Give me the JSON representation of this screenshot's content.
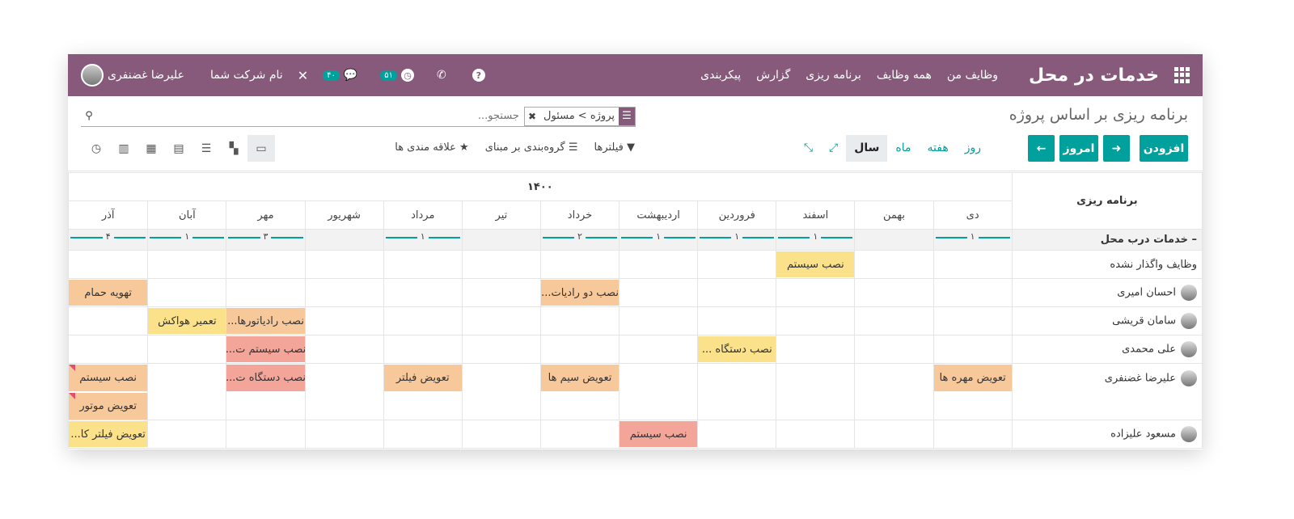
{
  "navbar": {
    "app_title": "خدمات در محل",
    "menu": [
      "وظایف من",
      "همه وظایف",
      "برنامه ریزی",
      "گزارش",
      "پیکربندی"
    ],
    "help_icon": "?",
    "activity_badge": "۵۱",
    "messages_badge": "۴۰",
    "company": "نام شرکت شما",
    "user": "علیرضا غضنفری",
    "colors": {
      "bar": "#875a7b",
      "badge": "#00a09d"
    }
  },
  "cp": {
    "breadcrumb": "برنامه ریزی بر اساس پروژه",
    "facet_value": "پروژه > مسئول",
    "search_placeholder": "جستجو...",
    "add_button": "افزودن",
    "today_button": "امروز",
    "scales": [
      "روز",
      "هفته",
      "ماه",
      "سال"
    ],
    "filters_label": "فیلترها",
    "groupby_label": "گروه‌بندی بر مبنای",
    "favorites_label": "علاقه مندی ها"
  },
  "gantt": {
    "header_label": "برنامه ریزی",
    "year": "۱۴۰۰",
    "months": [
      "دی",
      "بهمن",
      "اسفند",
      "فروردین",
      "اردیبهشت",
      "خرداد",
      "تیر",
      "مرداد",
      "شهریور",
      "مهر",
      "آبان",
      "آذر"
    ],
    "group": {
      "label": "خدمات درب محل",
      "counts": [
        "۱",
        "",
        "۱",
        "۱",
        "۱",
        "۲",
        "",
        "۱",
        "",
        "۳",
        "۱",
        "۴"
      ]
    },
    "rows": [
      {
        "name": "وظایف واگذار نشده",
        "avatar": false
      },
      {
        "name": "احسان امیری",
        "avatar": true
      },
      {
        "name": "سامان قریشی",
        "avatar": true
      },
      {
        "name": "علی محمدی",
        "avatar": true
      },
      {
        "name": "علیرضا غضنفری",
        "avatar": true
      },
      {
        "name": "مسعود علیزاده",
        "avatar": true
      }
    ],
    "tasks": [
      {
        "label": "نصب سیستم",
        "color": "yellow"
      },
      {
        "label": "تهویه حمام",
        "color": "orange"
      },
      {
        "label": "نصب دو رادیات...",
        "color": "orange"
      },
      {
        "label": "تعمیر هواکش",
        "color": "yellow"
      },
      {
        "label": "نصب رادیاتورها...",
        "color": "orange"
      },
      {
        "label": "نصب سیستم ت...",
        "color": "red"
      },
      {
        "label": "نصب دستگاه ...",
        "color": "yellow"
      },
      {
        "label": "نصب سیستم",
        "color": "orange"
      },
      {
        "label": "نصب دستگاه ت...",
        "color": "red"
      },
      {
        "label": "تعویض فیلتر",
        "color": "orange"
      },
      {
        "label": "تعویض سیم ها",
        "color": "orange"
      },
      {
        "label": "تعویض مهره ها",
        "color": "orange"
      },
      {
        "label": "تعویض موتور",
        "color": "orange"
      },
      {
        "label": "تعویض فیلتر کا...",
        "color": "yellow"
      },
      {
        "label": "نصب سیستم",
        "color": "red"
      }
    ]
  }
}
